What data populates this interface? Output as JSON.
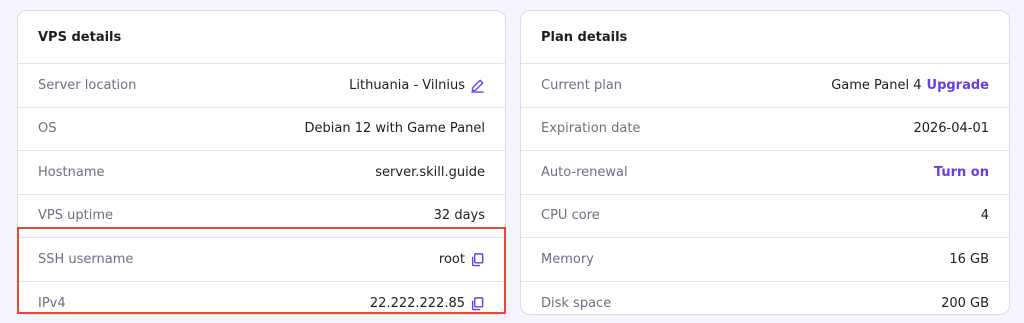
{
  "vps_details": {
    "title": "VPS details",
    "rows": [
      {
        "label": "Server location",
        "value": "Lithuania - Vilnius",
        "icon": "edit-icon"
      },
      {
        "label": "OS",
        "value": "Debian 12 with Game Panel"
      },
      {
        "label": "Hostname",
        "value": "server.skill.guide"
      },
      {
        "label": "VPS uptime",
        "value": "32 days"
      },
      {
        "label": "SSH username",
        "value": "root",
        "icon": "copy-icon"
      },
      {
        "label": "IPv4",
        "value": "22.222.222.85",
        "icon": "copy-icon"
      }
    ]
  },
  "plan_details": {
    "title": "Plan details",
    "rows": [
      {
        "label": "Current plan",
        "value": "Game Panel 4",
        "link": "Upgrade"
      },
      {
        "label": "Expiration date",
        "value": "2026-04-01"
      },
      {
        "label": "Auto-renewal",
        "link": "Turn on"
      },
      {
        "label": "CPU core",
        "value": "4"
      },
      {
        "label": "Memory",
        "value": "16 GB"
      },
      {
        "label": "Disk space",
        "value": "200 GB"
      }
    ]
  },
  "colors": {
    "accent": "#673de6",
    "highlight": "#e8492f",
    "background": "#f4f5ff"
  }
}
